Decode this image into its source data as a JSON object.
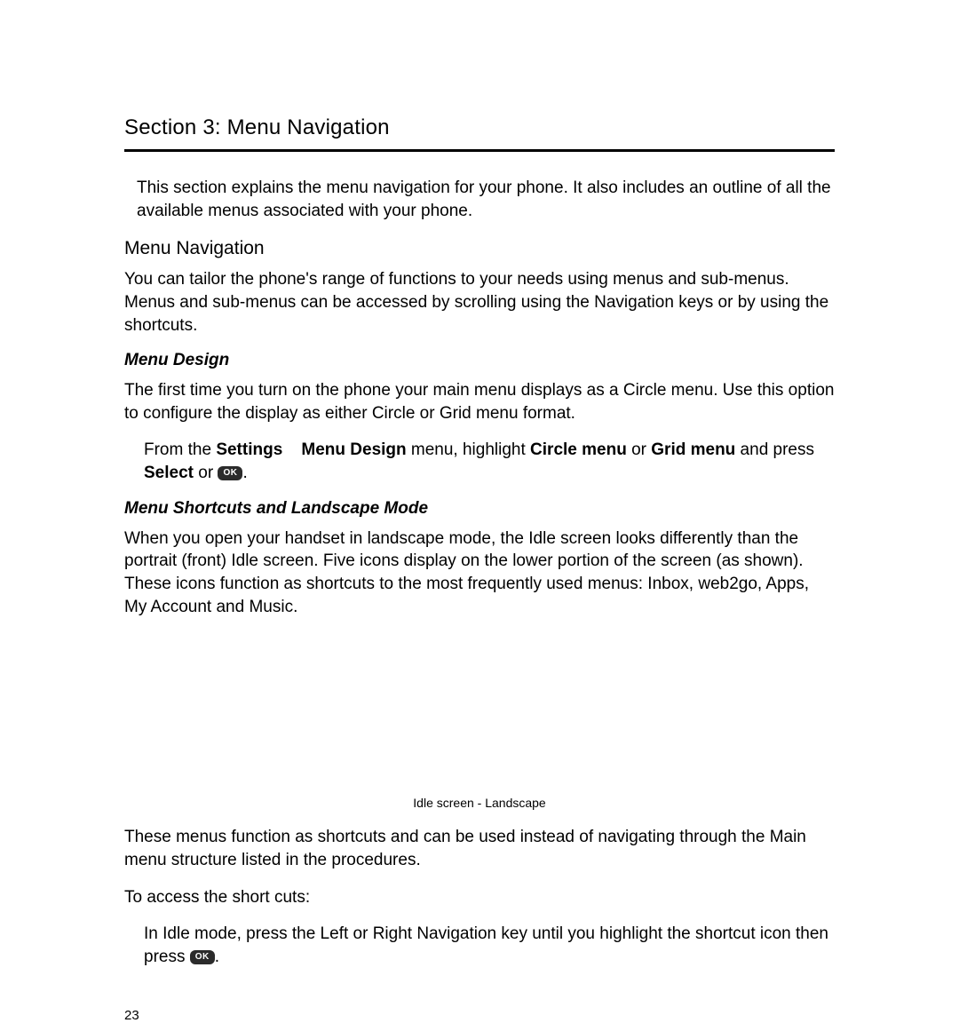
{
  "section_title": "Section 3: Menu Navigation",
  "intro": "This section explains the menu navigation for your phone. It also includes an outline of all the available menus associated with your phone.",
  "menu_nav": {
    "heading": "Menu Navigation",
    "para": "You can tailor the phone's range of functions to your needs using menus and sub-menus. Menus and sub-menus can be accessed by scrolling using the Navigation keys or by using the shortcuts."
  },
  "menu_design": {
    "heading": "Menu Design",
    "para": "The first time you turn on the phone your main menu displays as a Circle menu. Use this option to configure the display as either Circle or Grid menu format.",
    "step_pre": "From the ",
    "step_b1": "Settings",
    "step_mid1": "    ",
    "step_b2": "Menu Design",
    "step_mid2": " menu, highlight ",
    "step_b3": "Circle menu",
    "step_mid3": " or ",
    "step_b4": "Grid menu",
    "step_mid4": " and press ",
    "step_b5": "Select",
    "step_mid5": " or ",
    "step_post": ".",
    "ok": "OK"
  },
  "shortcuts": {
    "heading": "Menu Shortcuts and Landscape Mode",
    "para": "When you open your handset in landscape mode, the Idle screen looks differently than the portrait (front) Idle screen. Five icons display on the lower portion of the screen (as shown). These icons function as shortcuts to the most frequently used menus: Inbox, web2go, Apps, My Account and Music.",
    "caption": "Idle screen - Landscape",
    "para2": "These menus function as shortcuts and can be used instead of navigating through the Main menu structure listed in the procedures.",
    "para3": "To access the short cuts:",
    "step_pre": "In Idle mode, press the Left or Right Navigation key until you highlight the shortcut icon then press ",
    "step_post": ".",
    "ok": "OK"
  },
  "page_number": "23"
}
